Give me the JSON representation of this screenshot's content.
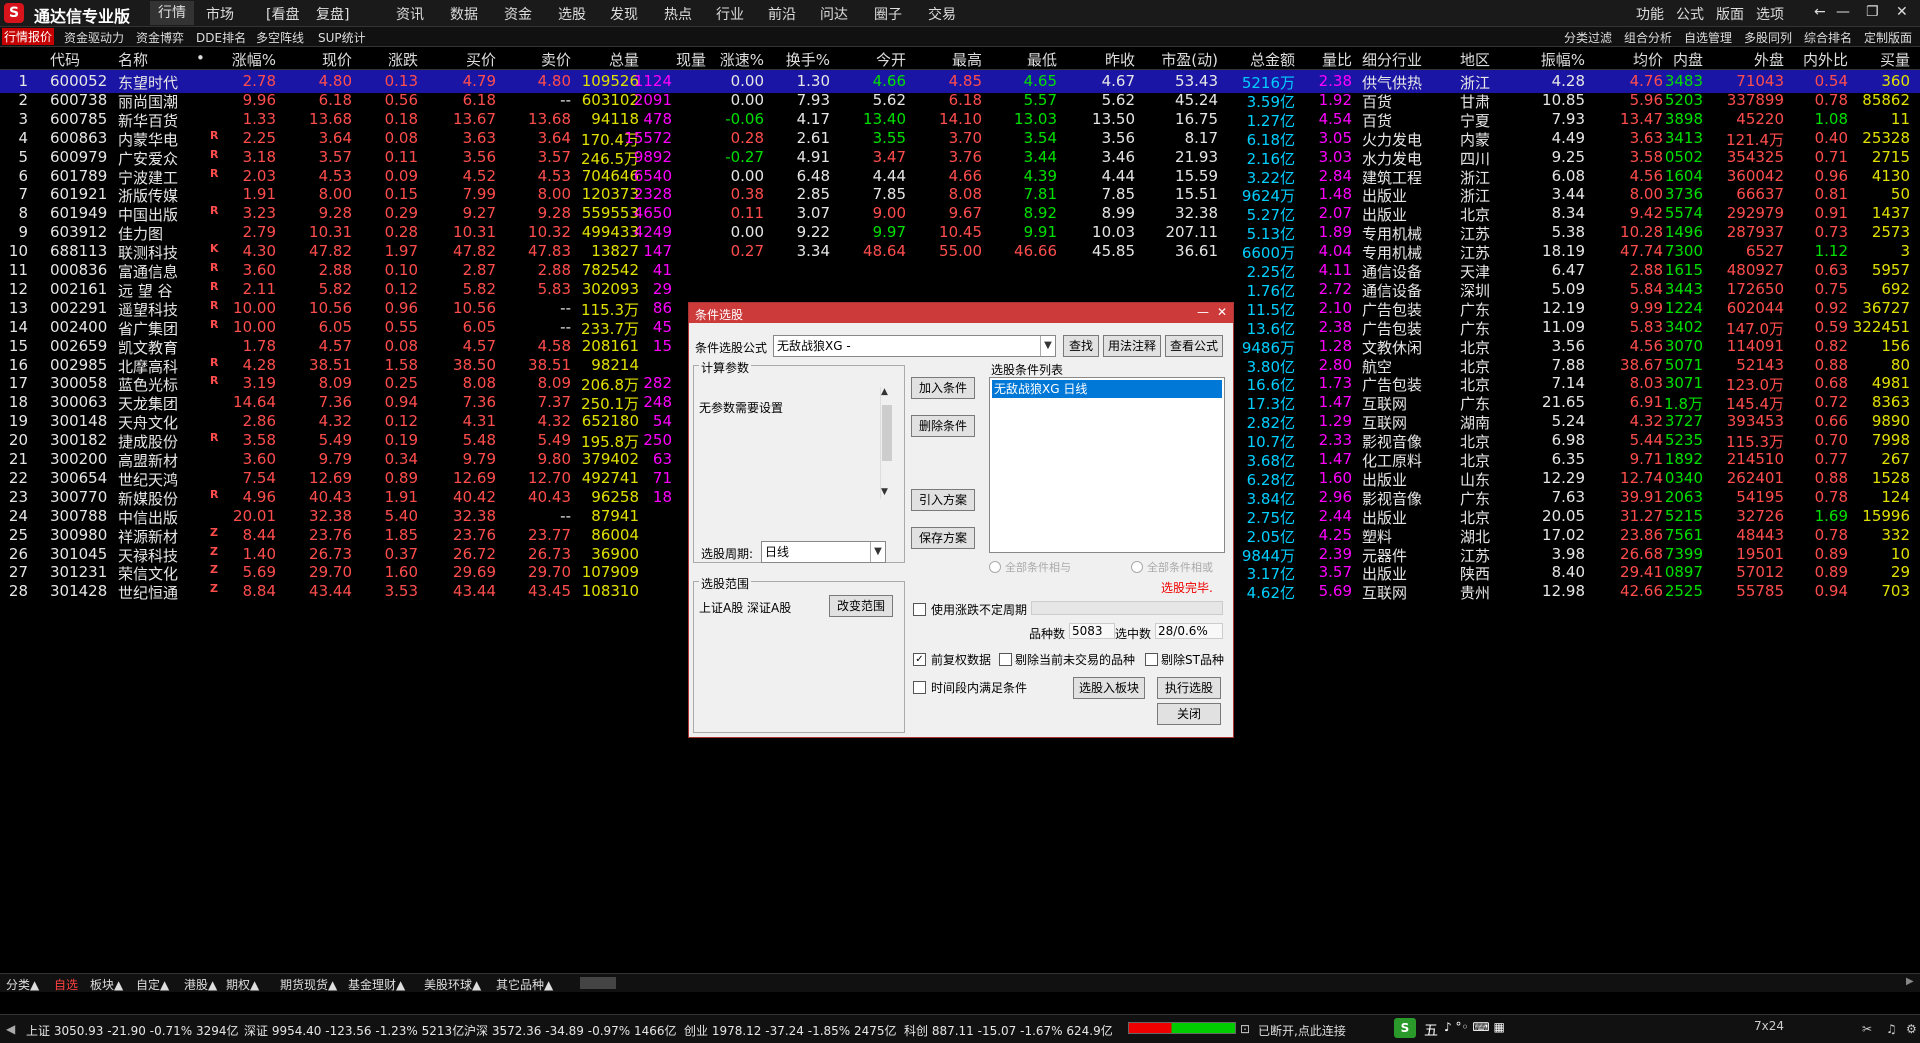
{
  "app": {
    "title": "通达信专业版"
  },
  "menus": [
    "行情",
    "市场",
    "[看盘",
    "复盘]",
    "资讯",
    "数据",
    "资金",
    "选股",
    "发现",
    "热点",
    "行业",
    "前沿",
    "问达",
    "圈子",
    "交易"
  ],
  "right_menus": [
    "功能",
    "公式",
    "版面",
    "选项"
  ],
  "toolbar_left": [
    "行情报价",
    "资金驱动力",
    "资金博弈",
    "DDE排名",
    "多空阵线",
    "SUP统计"
  ],
  "toolbar_right": [
    "分类过滤",
    "组合分析",
    "自选管理",
    "多股同列",
    "综合排名",
    "定制版面"
  ],
  "headers": [
    "代码",
    "名称",
    "•",
    "涨幅%",
    "现价",
    "涨跌",
    "买价",
    "卖价",
    "总量",
    "现量",
    "涨速%",
    "换手%",
    "今开",
    "最高",
    "最低",
    "昨收",
    "市盈(动)",
    "总金额",
    "量比",
    "细分行业",
    "地区",
    "振幅%",
    "均价",
    "内盘",
    "外盘",
    "内外比",
    "买量"
  ],
  "rows": [
    {
      "n": "1",
      "code": "600052",
      "name": "东望时代",
      "flag": "",
      "chg_pct": "2.78",
      "price": "4.80",
      "chg": "0.13",
      "bid": "4.79",
      "ask": "4.80",
      "vol": "109526",
      "cur": "1124",
      "speed": "0.00",
      "turn": "1.30",
      "open": "4.66",
      "high": "4.85",
      "low": "4.65",
      "prev": "4.67",
      "pe": "53.43",
      "amount": "5216万",
      "vr": "2.38",
      "ind": "供气供热",
      "region": "浙江",
      "amp": "4.28",
      "avg": "4.76",
      "inner": "3483",
      "outer": "71043",
      "io": "0.54",
      "bidvol": "360"
    },
    {
      "n": "2",
      "code": "600738",
      "name": "丽尚国潮",
      "flag": "",
      "chg_pct": "9.96",
      "price": "6.18",
      "chg": "0.56",
      "bid": "6.18",
      "ask": "--",
      "vol": "603102",
      "cur": "2091",
      "speed": "0.00",
      "turn": "7.93",
      "open": "5.62",
      "high": "6.18",
      "low": "5.57",
      "prev": "5.62",
      "pe": "45.24",
      "amount": "3.59亿",
      "vr": "1.92",
      "ind": "百货",
      "region": "甘肃",
      "amp": "10.85",
      "avg": "5.96",
      "inner": "5203",
      "outer": "337899",
      "io": "0.78",
      "bidvol": "85862"
    },
    {
      "n": "3",
      "code": "600785",
      "name": "新华百货",
      "flag": "",
      "chg_pct": "1.33",
      "price": "13.68",
      "chg": "0.18",
      "bid": "13.67",
      "ask": "13.68",
      "vol": "94118",
      "cur": "478",
      "speed": "-0.06",
      "turn": "4.17",
      "open": "13.40",
      "high": "14.10",
      "low": "13.03",
      "prev": "13.50",
      "pe": "16.75",
      "amount": "1.27亿",
      "vr": "4.54",
      "ind": "百货",
      "region": "宁夏",
      "amp": "7.93",
      "avg": "13.47",
      "inner": "3898",
      "outer": "45220",
      "io": "1.08",
      "bidvol": "11"
    },
    {
      "n": "4",
      "code": "600863",
      "name": "内蒙华电",
      "flag": "R",
      "chg_pct": "2.25",
      "price": "3.64",
      "chg": "0.08",
      "bid": "3.63",
      "ask": "3.64",
      "vol": "170.4万",
      "cur": "15572",
      "speed": "0.28",
      "turn": "2.61",
      "open": "3.55",
      "high": "3.70",
      "low": "3.54",
      "prev": "3.56",
      "pe": "8.17",
      "amount": "6.18亿",
      "vr": "3.05",
      "ind": "火力发电",
      "region": "内蒙",
      "amp": "4.49",
      "avg": "3.63",
      "inner": "3413",
      "outer": "121.4万",
      "io": "0.40",
      "bidvol": "25328"
    },
    {
      "n": "5",
      "code": "600979",
      "name": "广安爱众",
      "flag": "R",
      "chg_pct": "3.18",
      "price": "3.57",
      "chg": "0.11",
      "bid": "3.56",
      "ask": "3.57",
      "vol": "246.5万",
      "cur": "9892",
      "speed": "-0.27",
      "turn": "4.91",
      "open": "3.47",
      "high": "3.76",
      "low": "3.44",
      "prev": "3.46",
      "pe": "21.93",
      "amount": "2.16亿",
      "vr": "3.03",
      "ind": "水力发电",
      "region": "四川",
      "amp": "9.25",
      "avg": "3.58",
      "inner": "0502",
      "outer": "354325",
      "io": "0.71",
      "bidvol": "2715"
    },
    {
      "n": "6",
      "code": "601789",
      "name": "宁波建工",
      "flag": "R",
      "chg_pct": "2.03",
      "price": "4.53",
      "chg": "0.09",
      "bid": "4.52",
      "ask": "4.53",
      "vol": "704646",
      "cur": "6540",
      "speed": "0.00",
      "turn": "6.48",
      "open": "4.44",
      "high": "4.66",
      "low": "4.39",
      "prev": "4.44",
      "pe": "15.59",
      "amount": "3.22亿",
      "vr": "2.84",
      "ind": "建筑工程",
      "region": "浙江",
      "amp": "6.08",
      "avg": "4.56",
      "inner": "1604",
      "outer": "360042",
      "io": "0.96",
      "bidvol": "4130"
    },
    {
      "n": "7",
      "code": "601921",
      "name": "浙版传媒",
      "flag": "",
      "chg_pct": "1.91",
      "price": "8.00",
      "chg": "0.15",
      "bid": "7.99",
      "ask": "8.00",
      "vol": "120373",
      "cur": "2328",
      "speed": "0.38",
      "turn": "2.85",
      "open": "7.85",
      "high": "8.08",
      "low": "7.81",
      "prev": "7.85",
      "pe": "15.51",
      "amount": "9624万",
      "vr": "1.48",
      "ind": "出版业",
      "region": "浙江",
      "amp": "3.44",
      "avg": "8.00",
      "inner": "3736",
      "outer": "66637",
      "io": "0.81",
      "bidvol": "50"
    },
    {
      "n": "8",
      "code": "601949",
      "name": "中国出版",
      "flag": "R",
      "chg_pct": "3.23",
      "price": "9.28",
      "chg": "0.29",
      "bid": "9.27",
      "ask": "9.28",
      "vol": "559553",
      "cur": "4650",
      "speed": "0.11",
      "turn": "3.07",
      "open": "9.00",
      "high": "9.67",
      "low": "8.92",
      "prev": "8.99",
      "pe": "32.38",
      "amount": "5.27亿",
      "vr": "2.07",
      "ind": "出版业",
      "region": "北京",
      "amp": "8.34",
      "avg": "9.42",
      "inner": "5574",
      "outer": "292979",
      "io": "0.91",
      "bidvol": "1437"
    },
    {
      "n": "9",
      "code": "603912",
      "name": "佳力图",
      "flag": "",
      "chg_pct": "2.79",
      "price": "10.31",
      "chg": "0.28",
      "bid": "10.31",
      "ask": "10.32",
      "vol": "499433",
      "cur": "4249",
      "speed": "0.00",
      "turn": "9.22",
      "open": "9.97",
      "high": "10.45",
      "low": "9.91",
      "prev": "10.03",
      "pe": "207.11",
      "amount": "5.13亿",
      "vr": "1.89",
      "ind": "专用机械",
      "region": "江苏",
      "amp": "5.38",
      "avg": "10.28",
      "inner": "1496",
      "outer": "287937",
      "io": "0.73",
      "bidvol": "2573"
    },
    {
      "n": "10",
      "code": "688113",
      "name": "联测科技",
      "flag": "K",
      "chg_pct": "4.30",
      "price": "47.82",
      "chg": "1.97",
      "bid": "47.82",
      "ask": "47.83",
      "vol": "13827",
      "cur": "147",
      "speed": "0.27",
      "turn": "3.34",
      "open": "48.64",
      "high": "55.00",
      "low": "46.66",
      "prev": "45.85",
      "pe": "36.61",
      "amount": "6600万",
      "vr": "4.04",
      "ind": "专用机械",
      "region": "江苏",
      "amp": "18.19",
      "avg": "47.74",
      "inner": "7300",
      "outer": "6527",
      "io": "1.12",
      "bidvol": "3"
    },
    {
      "n": "11",
      "code": "000836",
      "name": "富通信息",
      "flag": "R",
      "chg_pct": "3.60",
      "price": "2.88",
      "chg": "0.10",
      "bid": "2.87",
      "ask": "2.88",
      "vol": "782542",
      "cur": "41",
      "speed": "",
      "turn": "",
      "open": "",
      "high": "",
      "low": "",
      "prev": "",
      "pe": "",
      "amount": "2.25亿",
      "vr": "4.11",
      "ind": "通信设备",
      "region": "天津",
      "amp": "6.47",
      "avg": "2.88",
      "inner": "1615",
      "outer": "480927",
      "io": "0.63",
      "bidvol": "5957"
    },
    {
      "n": "12",
      "code": "002161",
      "name": "远 望 谷",
      "flag": "R",
      "chg_pct": "2.11",
      "price": "5.82",
      "chg": "0.12",
      "bid": "5.82",
      "ask": "5.83",
      "vol": "302093",
      "cur": "29",
      "speed": "",
      "turn": "",
      "open": "",
      "high": "",
      "low": "",
      "prev": "",
      "pe": "",
      "amount": "1.76亿",
      "vr": "2.72",
      "ind": "通信设备",
      "region": "深圳",
      "amp": "5.09",
      "avg": "5.84",
      "inner": "3443",
      "outer": "172650",
      "io": "0.75",
      "bidvol": "692"
    },
    {
      "n": "13",
      "code": "002291",
      "name": "遥望科技",
      "flag": "R",
      "chg_pct": "10.00",
      "price": "10.56",
      "chg": "0.96",
      "bid": "10.56",
      "ask": "--",
      "vol": "115.3万",
      "cur": "86",
      "speed": "",
      "turn": "",
      "open": "",
      "high": "",
      "low": "",
      "prev": "",
      "pe": "",
      "amount": "11.5亿",
      "vr": "2.10",
      "ind": "广告包装",
      "region": "广东",
      "amp": "12.19",
      "avg": "9.99",
      "inner": "1224",
      "outer": "602044",
      "io": "0.92",
      "bidvol": "36727"
    },
    {
      "n": "14",
      "code": "002400",
      "name": "省广集团",
      "flag": "R",
      "chg_pct": "10.00",
      "price": "6.05",
      "chg": "0.55",
      "bid": "6.05",
      "ask": "--",
      "vol": "233.7万",
      "cur": "45",
      "speed": "",
      "turn": "",
      "open": "",
      "high": "",
      "low": "",
      "prev": "",
      "pe": "",
      "amount": "13.6亿",
      "vr": "2.38",
      "ind": "广告包装",
      "region": "广东",
      "amp": "11.09",
      "avg": "5.83",
      "inner": "3402",
      "outer": "147.0万",
      "io": "0.59",
      "bidvol": "322451"
    },
    {
      "n": "15",
      "code": "002659",
      "name": "凯文教育",
      "flag": "",
      "chg_pct": "1.78",
      "price": "4.57",
      "chg": "0.08",
      "bid": "4.57",
      "ask": "4.58",
      "vol": "208161",
      "cur": "15",
      "speed": "",
      "turn": "",
      "open": "",
      "high": "",
      "low": "",
      "prev": "",
      "pe": "",
      "amount": "9486万",
      "vr": "1.28",
      "ind": "文教休闲",
      "region": "北京",
      "amp": "3.56",
      "avg": "4.56",
      "inner": "3070",
      "outer": "114091",
      "io": "0.82",
      "bidvol": "156"
    },
    {
      "n": "16",
      "code": "002985",
      "name": "北摩高科",
      "flag": "R",
      "chg_pct": "4.28",
      "price": "38.51",
      "chg": "1.58",
      "bid": "38.50",
      "ask": "38.51",
      "vol": "98214",
      "cur": "",
      "speed": "",
      "turn": "",
      "open": "",
      "high": "",
      "low": "",
      "prev": "",
      "pe": "",
      "amount": "3.80亿",
      "vr": "2.80",
      "ind": "航空",
      "region": "北京",
      "amp": "7.88",
      "avg": "38.67",
      "inner": "5071",
      "outer": "52143",
      "io": "0.88",
      "bidvol": "80"
    },
    {
      "n": "17",
      "code": "300058",
      "name": "蓝色光标",
      "flag": "R",
      "chg_pct": "3.19",
      "price": "8.09",
      "chg": "0.25",
      "bid": "8.08",
      "ask": "8.09",
      "vol": "206.8万",
      "cur": "282",
      "speed": "",
      "turn": "",
      "open": "",
      "high": "",
      "low": "",
      "prev": "",
      "pe": "",
      "amount": "16.6亿",
      "vr": "1.73",
      "ind": "广告包装",
      "region": "北京",
      "amp": "7.14",
      "avg": "8.03",
      "inner": "3071",
      "outer": "123.0万",
      "io": "0.68",
      "bidvol": "4981"
    },
    {
      "n": "18",
      "code": "300063",
      "name": "天龙集团",
      "flag": "",
      "chg_pct": "14.64",
      "price": "7.36",
      "chg": "0.94",
      "bid": "7.36",
      "ask": "7.37",
      "vol": "250.1万",
      "cur": "248",
      "speed": "",
      "turn": "",
      "open": "",
      "high": "",
      "low": "",
      "prev": "",
      "pe": "",
      "amount": "17.3亿",
      "vr": "1.47",
      "ind": "互联网",
      "region": "广东",
      "amp": "21.65",
      "avg": "6.91",
      "inner": "1.8万",
      "outer": "145.4万",
      "io": "0.72",
      "bidvol": "8363"
    },
    {
      "n": "19",
      "code": "300148",
      "name": "天舟文化",
      "flag": "",
      "chg_pct": "2.86",
      "price": "4.32",
      "chg": "0.12",
      "bid": "4.31",
      "ask": "4.32",
      "vol": "652180",
      "cur": "54",
      "speed": "",
      "turn": "",
      "open": "",
      "high": "",
      "low": "",
      "prev": "",
      "pe": "",
      "amount": "2.82亿",
      "vr": "1.29",
      "ind": "互联网",
      "region": "湖南",
      "amp": "5.24",
      "avg": "4.32",
      "inner": "3727",
      "outer": "393453",
      "io": "0.66",
      "bidvol": "9890"
    },
    {
      "n": "20",
      "code": "300182",
      "name": "捷成股份",
      "flag": "R",
      "chg_pct": "3.58",
      "price": "5.49",
      "chg": "0.19",
      "bid": "5.48",
      "ask": "5.49",
      "vol": "195.8万",
      "cur": "250",
      "speed": "",
      "turn": "",
      "open": "",
      "high": "",
      "low": "",
      "prev": "",
      "pe": "",
      "amount": "10.7亿",
      "vr": "2.33",
      "ind": "影视音像",
      "region": "北京",
      "amp": "6.98",
      "avg": "5.44",
      "inner": "5235",
      "outer": "115.3万",
      "io": "0.70",
      "bidvol": "7998"
    },
    {
      "n": "21",
      "code": "300200",
      "name": "高盟新材",
      "flag": "",
      "chg_pct": "3.60",
      "price": "9.79",
      "chg": "0.34",
      "bid": "9.79",
      "ask": "9.80",
      "vol": "379402",
      "cur": "63",
      "speed": "",
      "turn": "",
      "open": "",
      "high": "",
      "low": "",
      "prev": "",
      "pe": "",
      "amount": "3.68亿",
      "vr": "1.47",
      "ind": "化工原料",
      "region": "北京",
      "amp": "6.35",
      "avg": "9.71",
      "inner": "1892",
      "outer": "214510",
      "io": "0.77",
      "bidvol": "267"
    },
    {
      "n": "22",
      "code": "300654",
      "name": "世纪天鸿",
      "flag": "",
      "chg_pct": "7.54",
      "price": "12.69",
      "chg": "0.89",
      "bid": "12.69",
      "ask": "12.70",
      "vol": "492741",
      "cur": "71",
      "speed": "",
      "turn": "",
      "open": "",
      "high": "",
      "low": "",
      "prev": "",
      "pe": "",
      "amount": "6.28亿",
      "vr": "1.60",
      "ind": "出版业",
      "region": "山东",
      "amp": "12.29",
      "avg": "12.74",
      "inner": "0340",
      "outer": "262401",
      "io": "0.88",
      "bidvol": "1528"
    },
    {
      "n": "23",
      "code": "300770",
      "name": "新媒股份",
      "flag": "R",
      "chg_pct": "4.96",
      "price": "40.43",
      "chg": "1.91",
      "bid": "40.42",
      "ask": "40.43",
      "vol": "96258",
      "cur": "18",
      "speed": "",
      "turn": "",
      "open": "",
      "high": "",
      "low": "",
      "prev": "",
      "pe": "",
      "amount": "3.84亿",
      "vr": "2.96",
      "ind": "影视音像",
      "region": "广东",
      "amp": "7.63",
      "avg": "39.91",
      "inner": "2063",
      "outer": "54195",
      "io": "0.78",
      "bidvol": "124"
    },
    {
      "n": "24",
      "code": "300788",
      "name": "中信出版",
      "flag": "",
      "chg_pct": "20.01",
      "price": "32.38",
      "chg": "5.40",
      "bid": "32.38",
      "ask": "--",
      "vol": "87941",
      "cur": "",
      "speed": "",
      "turn": "",
      "open": "",
      "high": "",
      "low": "",
      "prev": "",
      "pe": "",
      "amount": "2.75亿",
      "vr": "2.44",
      "ind": "出版业",
      "region": "北京",
      "amp": "20.05",
      "avg": "31.27",
      "inner": "5215",
      "outer": "32726",
      "io": "1.69",
      "bidvol": "15996"
    },
    {
      "n": "25",
      "code": "300980",
      "name": "祥源新材",
      "flag": "Z",
      "chg_pct": "8.44",
      "price": "23.76",
      "chg": "1.85",
      "bid": "23.76",
      "ask": "23.77",
      "vol": "86004",
      "cur": "",
      "speed": "",
      "turn": "",
      "open": "",
      "high": "",
      "low": "",
      "prev": "",
      "pe": "",
      "amount": "2.05亿",
      "vr": "4.25",
      "ind": "塑料",
      "region": "湖北",
      "amp": "17.02",
      "avg": "23.86",
      "inner": "7561",
      "outer": "48443",
      "io": "0.78",
      "bidvol": "332"
    },
    {
      "n": "26",
      "code": "301045",
      "name": "天禄科技",
      "flag": "Z",
      "chg_pct": "1.40",
      "price": "26.73",
      "chg": "0.37",
      "bid": "26.72",
      "ask": "26.73",
      "vol": "36900",
      "cur": "",
      "speed": "",
      "turn": "",
      "open": "",
      "high": "",
      "low": "",
      "prev": "",
      "pe": "",
      "amount": "9844万",
      "vr": "2.39",
      "ind": "元器件",
      "region": "江苏",
      "amp": "3.98",
      "avg": "26.68",
      "inner": "7399",
      "outer": "19501",
      "io": "0.89",
      "bidvol": "10"
    },
    {
      "n": "27",
      "code": "301231",
      "name": "荣信文化",
      "flag": "Z",
      "chg_pct": "5.69",
      "price": "29.70",
      "chg": "1.60",
      "bid": "29.69",
      "ask": "29.70",
      "vol": "107909",
      "cur": "",
      "speed": "",
      "turn": "",
      "open": "",
      "high": "",
      "low": "",
      "prev": "",
      "pe": "",
      "amount": "3.17亿",
      "vr": "3.57",
      "ind": "出版业",
      "region": "陕西",
      "amp": "8.40",
      "avg": "29.41",
      "inner": "0897",
      "outer": "57012",
      "io": "0.89",
      "bidvol": "29"
    },
    {
      "n": "28",
      "code": "301428",
      "name": "世纪恒通",
      "flag": "Z",
      "chg_pct": "8.84",
      "price": "43.44",
      "chg": "3.53",
      "bid": "43.44",
      "ask": "43.45",
      "vol": "108310",
      "cur": "",
      "speed": "",
      "turn": "",
      "open": "",
      "high": "",
      "low": "",
      "prev": "",
      "pe": "",
      "amount": "4.62亿",
      "vr": "5.69",
      "ind": "互联网",
      "region": "贵州",
      "amp": "12.98",
      "avg": "42.66",
      "inner": "2525",
      "outer": "55785",
      "io": "0.94",
      "bidvol": "703"
    }
  ],
  "bottom_tabs": [
    "分类▲",
    "自选",
    "板块▲",
    "自定▲",
    "港股▲",
    "期权▲",
    "期货现货▲",
    "基金理财▲",
    "美股环球▲",
    "其它品种▲"
  ],
  "status": {
    "sh": "上证 3050.93 -21.90 -0.71% 3294亿",
    "sz": "深证 9954.40 -123.56 -1.23% 5213亿",
    "hs": "沪深 3572.36 -34.89 -0.97% 1466亿",
    "cy": "创业 1978.12 -37.24 -1.85% 2475亿",
    "kc": "科创 887.11 -15.07 -1.67% 624.9亿",
    "conn": "已断开,点此连接",
    "ime": "五",
    "clock": "7x24"
  },
  "dialog": {
    "title": "条件选股",
    "formula_label": "条件选股公式",
    "formula_value": "无敌战狼XG  -",
    "btn_find": "查找",
    "btn_usage": "用法注释",
    "btn_view": "查看公式",
    "params_title": "计算参数",
    "params_text": "无参数需要设置",
    "period_label": "选股周期:",
    "period_value": "日线",
    "btn_add": "加入条件",
    "btn_del": "删除条件",
    "btn_import": "引入方案",
    "btn_save": "保存方案",
    "list_title": "选股条件列表",
    "list_item": "无敌战狼XG  日线",
    "radio_and": "全部条件相与",
    "radio_or": "全部条件相或",
    "done": "选股完毕.",
    "range_title": "选股范围",
    "range_text": "上证A股 深证A股",
    "btn_range": "改变范围",
    "chk_period": "使用涨跌不定周期",
    "count_label": "品种数",
    "count_value": "5083",
    "selected_label": "选中数",
    "selected_value": "28/0.6%",
    "chk_fq": "前复权数据",
    "chk_notrade": "剔除当前未交易的品种",
    "chk_st": "剔除ST品种",
    "chk_time": "时间段内满足条件",
    "btn_toblock": "选股入板块",
    "btn_exec": "执行选股",
    "btn_close": "关闭"
  }
}
